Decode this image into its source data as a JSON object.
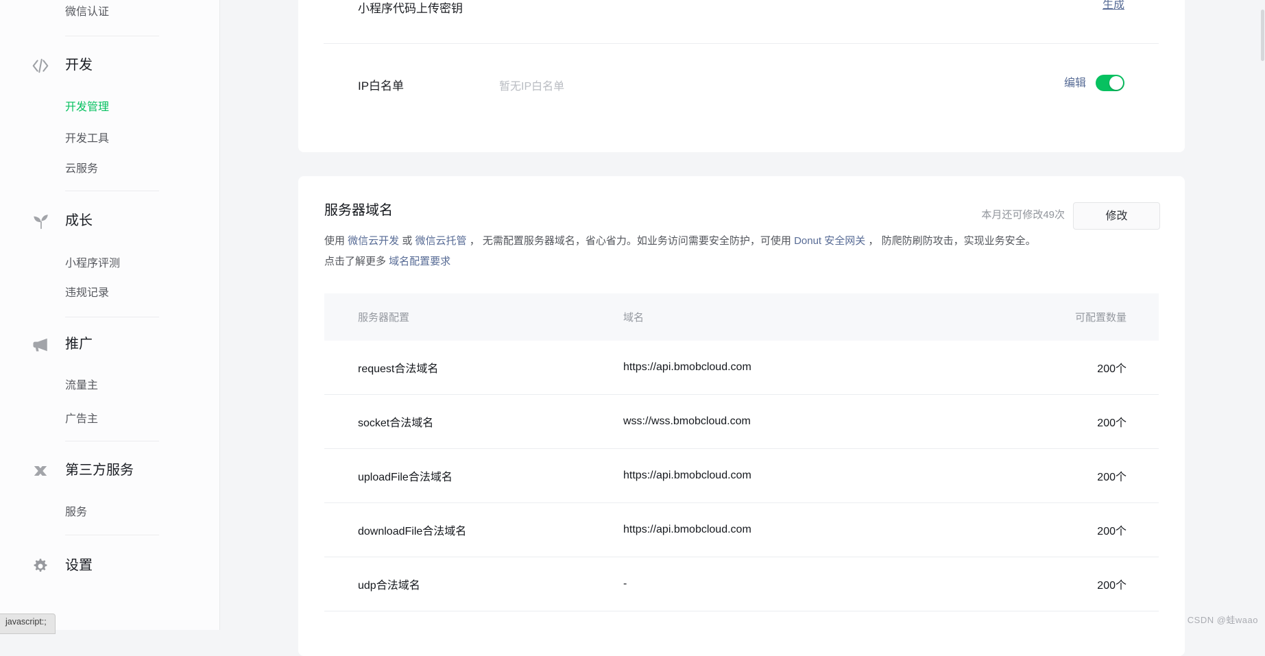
{
  "sidebar": {
    "top_item": "微信认证",
    "sections": [
      {
        "title": "开发",
        "icon": "code-icon",
        "items": [
          {
            "label": "开发管理",
            "active": true
          },
          {
            "label": "开发工具"
          },
          {
            "label": "云服务"
          }
        ]
      },
      {
        "title": "成长",
        "icon": "sprout-icon",
        "items": [
          {
            "label": "小程序评测"
          },
          {
            "label": "违规记录"
          }
        ]
      },
      {
        "title": "推广",
        "icon": "megaphone-icon",
        "items": [
          {
            "label": "流量主"
          },
          {
            "label": "广告主"
          }
        ]
      },
      {
        "title": "第三方服务",
        "icon": "third-party-icon",
        "items": [
          {
            "label": "服务"
          }
        ]
      },
      {
        "title": "设置",
        "icon": "gear-icon",
        "items": []
      }
    ]
  },
  "keys_card": {
    "upload_key_label": "小程序代码上传密钥",
    "upload_key_action": "生成",
    "ip_whitelist_label": "IP白名单",
    "ip_whitelist_placeholder": "暂无IP白名单",
    "ip_whitelist_edit": "编辑",
    "ip_whitelist_toggle": "on"
  },
  "domain_card": {
    "title": "服务器域名",
    "quota_text": "本月还可修改49次",
    "modify_button": "修改",
    "desc_line1": [
      {
        "text": "使用 ",
        "link": false
      },
      {
        "text": "微信云开发",
        "link": true
      },
      {
        "text": " 或 ",
        "link": false
      },
      {
        "text": "微信云托管",
        "link": true
      },
      {
        "text": " ， 无需配置服务器域名，省心省力。如业务访问需要安全防护，可使用 ",
        "link": false
      },
      {
        "text": "Donut 安全网关",
        "link": true
      },
      {
        "text": " ， 防爬防刷防攻击，实现业务安全。",
        "link": false
      }
    ],
    "desc_line2": [
      {
        "text": "点击了解更多 ",
        "link": false
      },
      {
        "text": "域名配置要求",
        "link": true
      }
    ],
    "table": {
      "headers": [
        "服务器配置",
        "域名",
        "可配置数量"
      ],
      "rows": [
        {
          "config": "request合法域名",
          "domain": "https://api.bmobcloud.com",
          "quota": "200个"
        },
        {
          "config": "socket合法域名",
          "domain": "wss://wss.bmobcloud.com",
          "quota": "200个"
        },
        {
          "config": "uploadFile合法域名",
          "domain": "https://api.bmobcloud.com",
          "quota": "200个"
        },
        {
          "config": "downloadFile合法域名",
          "domain": "https://api.bmobcloud.com",
          "quota": "200个"
        },
        {
          "config": "udp合法域名",
          "domain": "-",
          "quota": "200个"
        }
      ]
    }
  },
  "watermark": "CSDN @蛙waao",
  "status_tooltip": "javascript:;",
  "colors": {
    "accent_green": "#07c160",
    "link_blue": "#576b95"
  }
}
